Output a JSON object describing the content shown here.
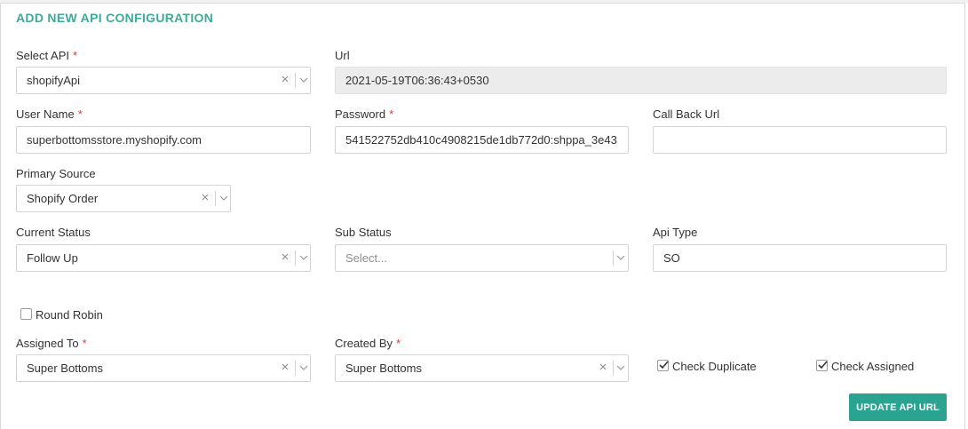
{
  "title": "ADD NEW API CONFIGURATION",
  "required_mark": "*",
  "fields": {
    "select_api": {
      "label": "Select API",
      "value": "shopifyApi"
    },
    "url": {
      "label": "Url",
      "value": "2021-05-19T06:36:43+0530"
    },
    "user_name": {
      "label": "User Name",
      "value": "superbottomsstore.myshopify.com"
    },
    "password": {
      "label": "Password",
      "value": "541522752db410c4908215de1db772d0:shppa_3e43"
    },
    "call_back_url": {
      "label": "Call Back Url",
      "value": ""
    },
    "primary_source": {
      "label": "Primary Source",
      "value": "Shopify Order"
    },
    "current_status": {
      "label": "Current Status",
      "value": "Follow Up"
    },
    "sub_status": {
      "label": "Sub Status",
      "placeholder": "Select..."
    },
    "api_type": {
      "label": "Api Type",
      "value": "SO"
    },
    "assigned_to": {
      "label": "Assigned To",
      "value": "Super Bottoms"
    },
    "created_by": {
      "label": "Created By",
      "value": "Super Bottoms"
    }
  },
  "checkboxes": {
    "round_robin": {
      "label": "Round Robin",
      "checked": false
    },
    "check_duplicate": {
      "label": "Check Duplicate",
      "checked": true
    },
    "check_assigned": {
      "label": "Check Assigned",
      "checked": true
    }
  },
  "clear_glyph": "×",
  "button": {
    "label": "UPDATE API URL"
  },
  "icons": {
    "clear": "close-icon",
    "dropdown": "chevron-down-icon",
    "check": "checkmark-icon"
  },
  "colors": {
    "accent": "#3fa99a",
    "button": "#2aa391",
    "required": "#e03a3a"
  }
}
